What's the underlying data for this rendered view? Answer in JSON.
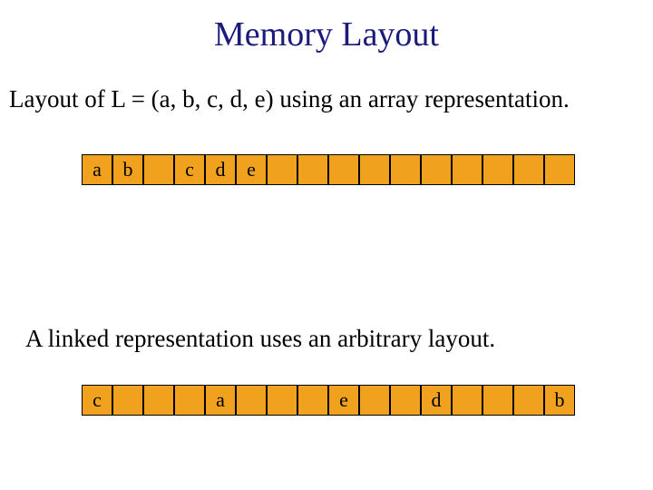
{
  "title": "Memory Layout",
  "desc1": "Layout of L = (a, b, c, d, e) using an array representation.",
  "desc2": "A linked representation uses an arbitrary layout.",
  "arrayCells": [
    "a",
    "b",
    "",
    "c",
    "d",
    "e",
    "",
    "",
    "",
    "",
    "",
    "",
    "",
    "",
    "",
    ""
  ],
  "linkedCells": [
    "c",
    "",
    "",
    "",
    "a",
    "",
    "",
    "",
    "e",
    "",
    "",
    "d",
    "",
    "",
    "",
    "b"
  ],
  "colors": {
    "cell": "#f0a21e",
    "title": "#1c1a7a"
  }
}
